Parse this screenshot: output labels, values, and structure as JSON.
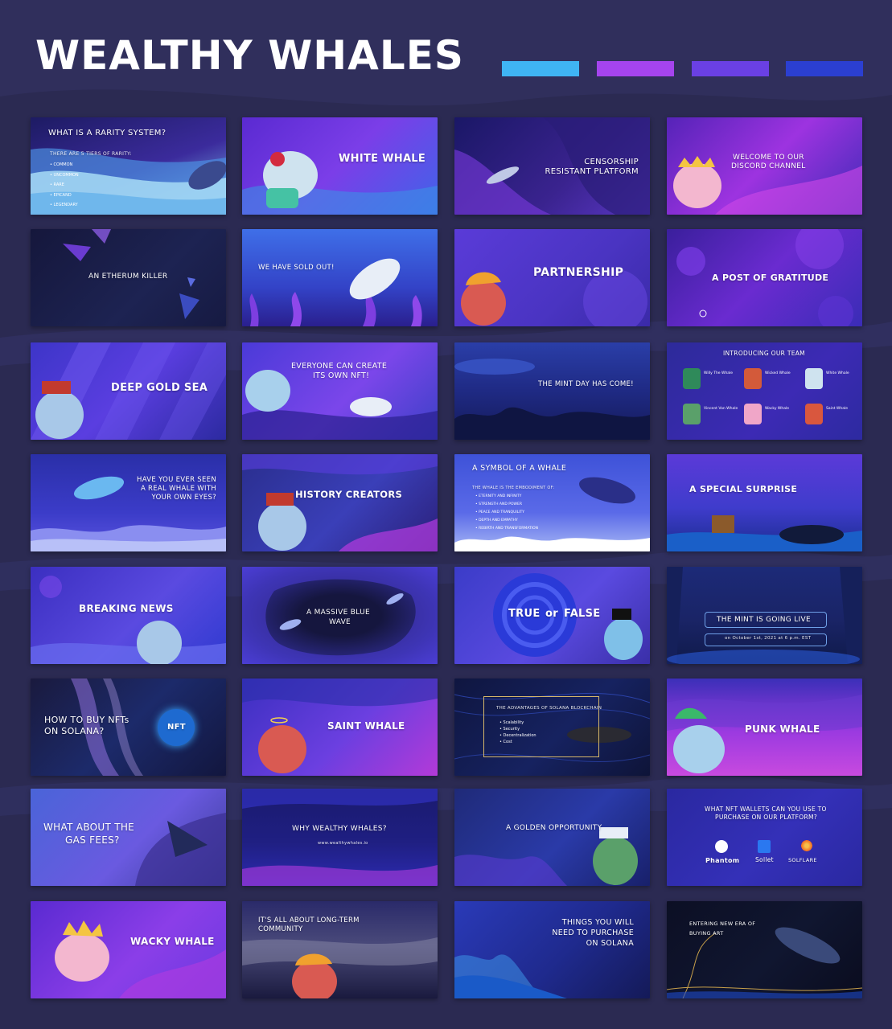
{
  "page": {
    "title": "WEALTHY WHALES",
    "swatches": [
      "#3fb4f4",
      "#a544ee",
      "#6a40e4",
      "#2b3fd1"
    ]
  },
  "cards": {
    "c1": {
      "title": "WHAT IS A RARITY SYSTEM?",
      "subtitle": "THERE ARE 5 TIERS OF RARITY:",
      "items": [
        "COMMON",
        "UNCOMMON",
        "RARE",
        "EPICAND",
        "LEGENDARY"
      ]
    },
    "c2": {
      "title": "WHITE WHALE"
    },
    "c3": {
      "line1": "CENSORSHIP",
      "line2": "RESISTANT PLATFORM"
    },
    "c4": {
      "line1": "WELCOME TO OUR",
      "line2": "DISCORD CHANNEL"
    },
    "c5": {
      "title": "AN ETHERUM KILLER"
    },
    "c6": {
      "title": "WE HAVE SOLD OUT!"
    },
    "c7": {
      "title": "PARTNERSHIP"
    },
    "c8": {
      "title": "A POST OF GRATITUDE"
    },
    "c9": {
      "title": "DEEP GOLD SEA"
    },
    "c10": {
      "line1": "EVERYONE CAN CREATE",
      "line2": "ITS OWN NFT!"
    },
    "c11": {
      "title": "THE MINT DAY HAS COME!"
    },
    "c12": {
      "title": "INTRODUCING OUR TEAM",
      "members": [
        "Willy The Whale",
        "Wicked Whale",
        "White Whale",
        "Vincent Van Whale",
        "Wacky Whale",
        "Saint Whale"
      ]
    },
    "c13": {
      "line1": "HAVE YOU EVER SEEN",
      "line2": "A REAL WHALE WITH",
      "line3": "YOUR OWN EYES?"
    },
    "c14": {
      "title": "HISTORY CREATORS"
    },
    "c15": {
      "title": "A SYMBOL OF A WHALE",
      "subtitle": "THE WHALE IS THE EMBODIMENT OF:",
      "items": [
        "ETERNITY AND INFINITY",
        "STRENGTH AND POWER",
        "PEACE AND TRANQUILITY",
        "DEPTH AND EMPATHY",
        "REBIRTH AND TRANSFORMATION"
      ]
    },
    "c16": {
      "title": "A SPECIAL SURPRISE"
    },
    "c17": {
      "title": "BREAKING NEWS"
    },
    "c18": {
      "line1": "A MASSIVE BLUE",
      "line2": "WAVE"
    },
    "c19": {
      "word1": "TRUE",
      "word2": "or",
      "word3": "FALSE"
    },
    "c20": {
      "title": "THE MINT IS GOING LIVE",
      "date": "on October 1st, 2021 at 6 p.m. EST"
    },
    "c21": {
      "line1": "HOW TO BUY NFTs",
      "line2": "ON SOLANA?",
      "badge": "NFT"
    },
    "c22": {
      "title": "SAINT WHALE"
    },
    "c23": {
      "title": "THE ADVANTAGES OF SOLANA BLOCKCHAIN",
      "items": [
        "Scalability",
        "Security",
        "Decentralization",
        "Cost"
      ]
    },
    "c24": {
      "title": "PUNK WHALE"
    },
    "c25": {
      "line1": "WHAT ABOUT THE",
      "line2": "GAS FEES?"
    },
    "c26": {
      "title": "WHY WEALTHY WHALES?",
      "url": "www.wealthywhales.io"
    },
    "c27": {
      "title": "A GOLDEN OPPORTUNITY"
    },
    "c28": {
      "line1": "WHAT NFT WALLETS CAN YOU USE TO",
      "line2": "PURCHASE ON OUR PLATFORM?",
      "wallets": [
        "Phantom",
        "Sollet",
        "SOLFLARE"
      ]
    },
    "c29": {
      "title": "WACKY WHALE"
    },
    "c30": {
      "line1": "IT'S ALL ABOUT LONG-TERM",
      "line2": "COMMUNITY"
    },
    "c31": {
      "line1": "THINGS YOU WILL",
      "line2": "NEED TO PURCHASE",
      "line3": "ON SOLANA"
    },
    "c32": {
      "line1": "ENTERING NEW ERA OF",
      "line2": "BUYING ART"
    }
  }
}
